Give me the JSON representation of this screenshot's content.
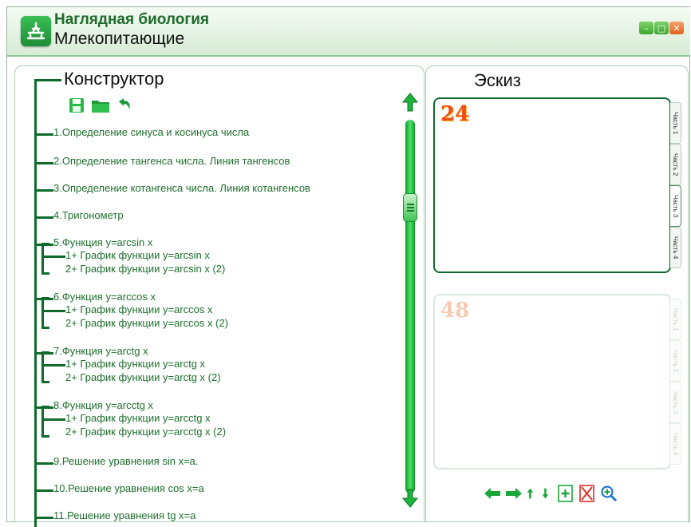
{
  "app": {
    "title": "Наглядная биология",
    "subtitle": "Млекопитающие"
  },
  "constructor": {
    "title": "Конструктор",
    "toolbar": [
      "save-icon",
      "open-folder-icon",
      "undo-icon"
    ],
    "items": [
      {
        "label": "1.Определение синуса и косинуса числа"
      },
      {
        "label": "2.Определение тангенса числа. Линия тангенсов"
      },
      {
        "label": "3.Определение котангенса числа. Линия котангенсов"
      },
      {
        "label": "4.Тригонометр"
      },
      {
        "label": "5.Функция y=arcsin x",
        "subs": [
          "1+ График функции y=arcsin x",
          "2+ График функции y=arcsin x (2)"
        ]
      },
      {
        "label": "6.Функция y=arccos x",
        "subs": [
          "1+ График функции y=arccos x",
          "2+ График функции y=arccos x (2)"
        ]
      },
      {
        "label": "7.Функция y=arctg x",
        "subs": [
          "1+ График функции y=arctg x",
          "2+ График функции y=arctg x (2)"
        ]
      },
      {
        "label": "8.Функция y=arcctg x",
        "subs": [
          "1+ График функции y=arcctg x",
          "2+ График функции y=arcctg x (2)"
        ]
      },
      {
        "label": "9.Решение уравнения sin x=a."
      },
      {
        "label": "10.Решение уравнения cos x=a"
      },
      {
        "label": "11.Решение уравнения tg x=a"
      }
    ]
  },
  "sketch": {
    "title": "Эскиз",
    "cards": [
      {
        "number": "24",
        "active": true,
        "tabs": [
          "Часть 1",
          "Часть 2",
          "Часть 3",
          "Часть 4"
        ]
      },
      {
        "number": "48",
        "active": false,
        "tabs": [
          "Часть 1",
          "Часть 2",
          "Часть 3",
          "Часть 4"
        ]
      }
    ],
    "tools": [
      "arrow-left-icon",
      "arrow-right-icon",
      "arrow-up-icon",
      "arrow-down-icon",
      "add-page-icon",
      "delete-icon",
      "zoom-icon"
    ]
  },
  "colors": {
    "accent": "#1f6e2e",
    "line": "#0f6a2b",
    "scroll": "#2bd048"
  }
}
